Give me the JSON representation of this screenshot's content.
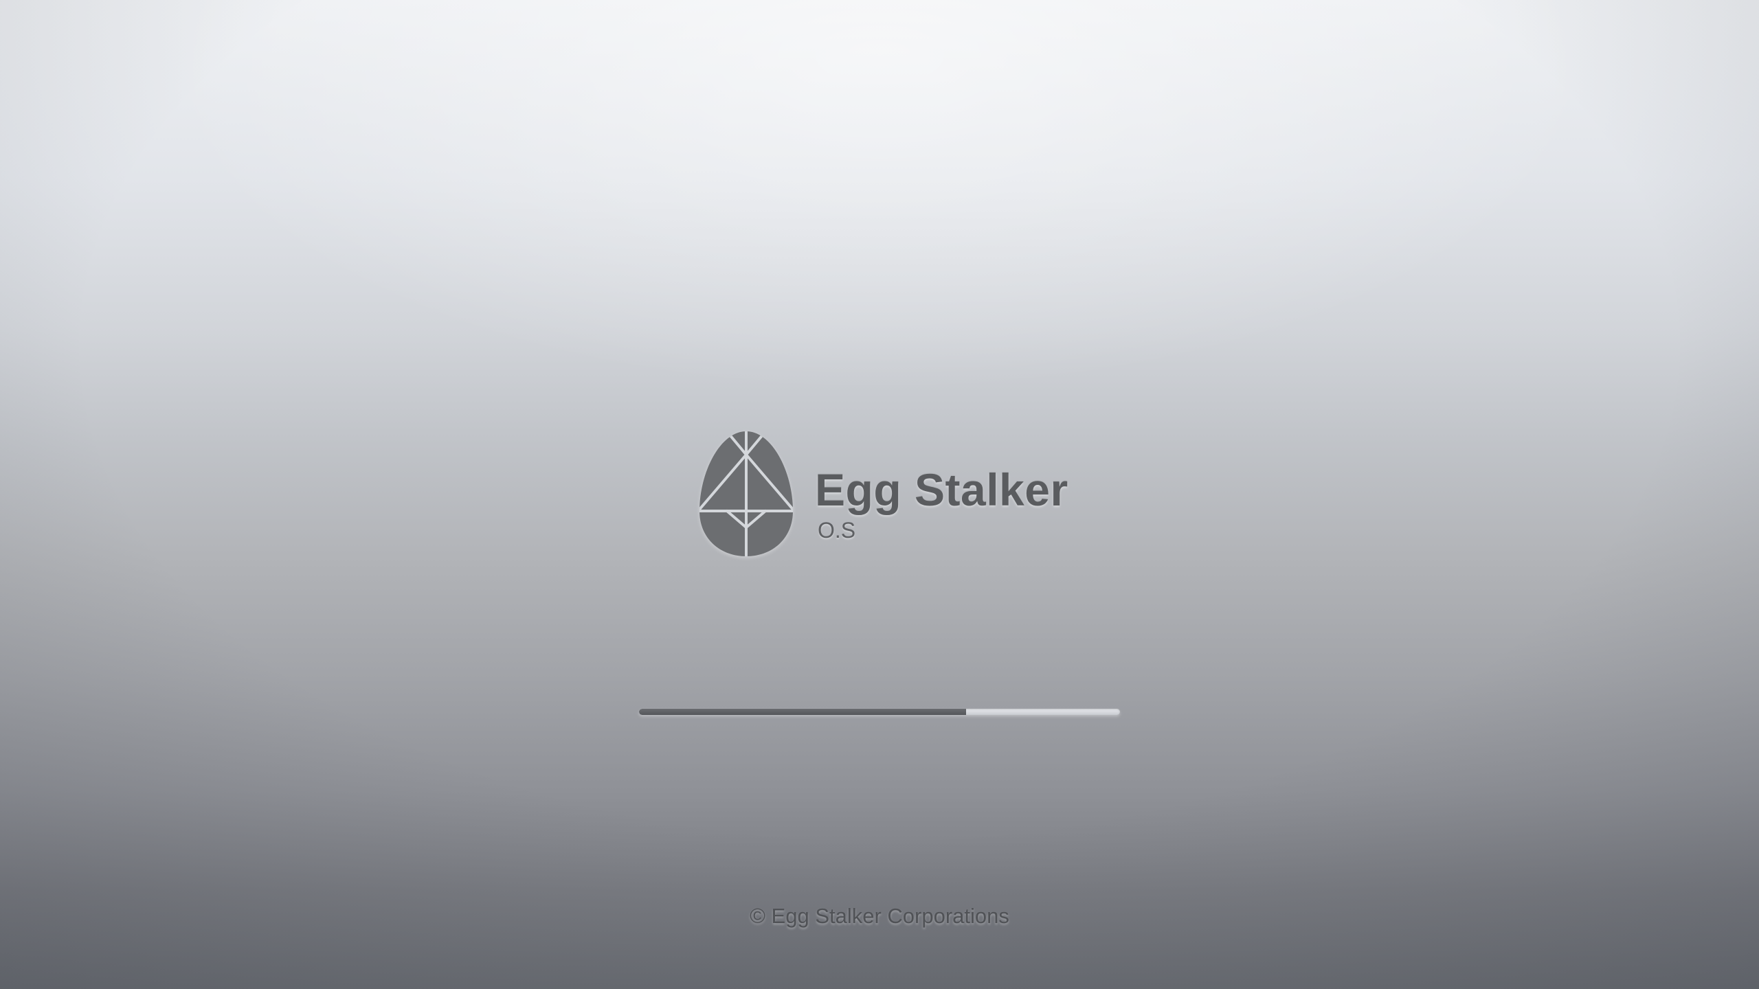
{
  "screen": "boot-splash",
  "brand": {
    "title": "Egg Stalker",
    "subtitle": "O.S",
    "logo_icon": "egg-logo-icon"
  },
  "boot_progress": {
    "fraction": 0.68
  },
  "footer": {
    "copyright": "© Egg Stalker Corporations"
  },
  "colors": {
    "logo_fill": "#6c6e71",
    "text": "#5a5c5f",
    "progress_fill": "#5e6064",
    "progress_track": "#d6d9dd"
  }
}
